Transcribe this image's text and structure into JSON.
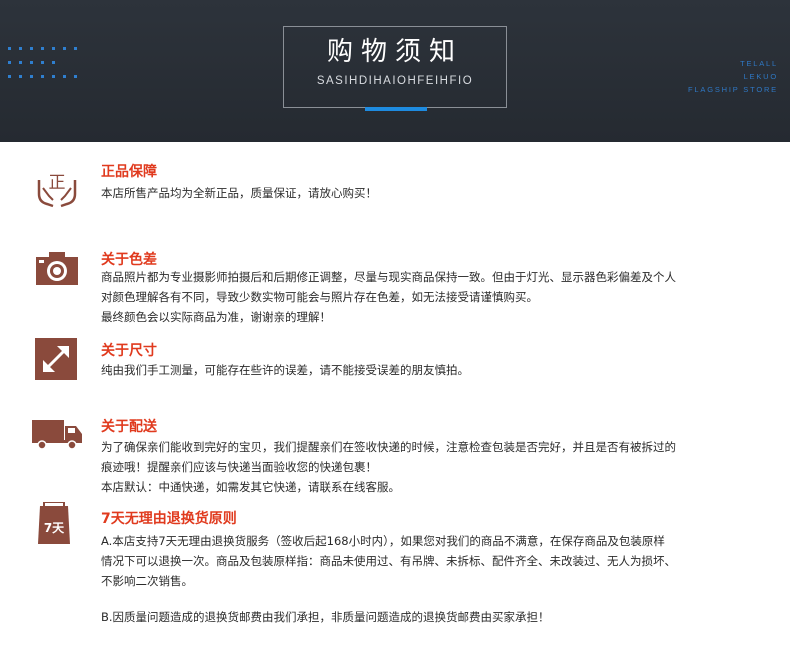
{
  "header": {
    "title_cn": "购物须知",
    "title_en": "SASIHDIHAIOHFEIHFIO",
    "store_tag": [
      "TELALL",
      "LEKUO",
      "FLAGSHIP STORE"
    ],
    "accent_color": "#1e8be0"
  },
  "sections": [
    {
      "icon": "hands-zheng-icon",
      "icon_text": "正",
      "title": "正品保障",
      "lines": [
        "本店所售产品均为全新正品，质量保证，请放心购买！"
      ]
    },
    {
      "icon": "camera-icon",
      "title": "关于色差",
      "lines": [
        "商品照片都为专业摄影师拍摄后和后期修正调整，尽量与现实商品保持一致。但由于灯光、显示器色彩偏差及个人",
        "对颜色理解各有不同，导致少数实物可能会与照片存在色差，如无法接受请谨慎购买。",
        "最终颜色会以实际商品为准，谢谢亲的理解！"
      ]
    },
    {
      "icon": "resize-arrow-icon",
      "title": "关于尺寸",
      "lines": [
        "纯由我们手工测量，可能存在些许的误差，请不能接受误差的朋友慎拍。"
      ]
    },
    {
      "icon": "truck-icon",
      "title": "关于配送",
      "lines": [
        "为了确保亲们能收到完好的宝贝，我们提醒亲们在签收快递的时候，注意检查包装是否完好，并且是否有被拆过的",
        "痕迹哦！提醒亲们应该与快递当面验收您的快递包裹！",
        "本店默认：中通快递，如需发其它快递，请联系在线客服。"
      ]
    },
    {
      "icon": "seven-day-bag-icon",
      "icon_text": "7天",
      "title": "7天无理由退换货原则",
      "lines": [
        "A.本店支持7天无理由退换货服务（签收后起168小时内），如果您对我们的商品不满意，在保存商品及包装原样",
        "情况下可以退换一次。商品及包装原样指：商品未使用过、有吊牌、未拆标、配件齐全、未改装过、无人为损坏、",
        "不影响二次销售。",
        "",
        "B.因质量问题造成的退换货邮费由我们承担，非质量问题造成的退换货邮费由买家承担！"
      ]
    }
  ],
  "colors": {
    "section_title": "#e03a1e",
    "icon_brown": "#8a4a3c",
    "header_bg": "#2a3038"
  }
}
